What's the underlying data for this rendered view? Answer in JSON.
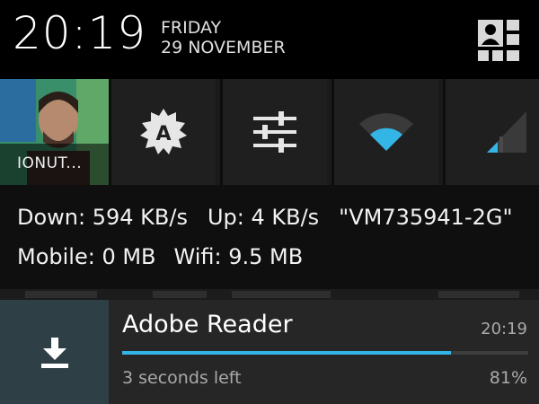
{
  "status": {
    "time": "20:19",
    "day": "FRIDAY",
    "date": "29 NOVEMBER"
  },
  "quick_settings": {
    "profile_name": "IONUT...",
    "tiles": [
      "user-grid-icon",
      "auto-brightness-icon",
      "settings-sliders-icon",
      "wifi-icon",
      "cell-signal-icon"
    ]
  },
  "network": {
    "down": "Down: 594 KB/s",
    "up": "Up: 4 KB/s",
    "ssid": "\"VM735941-2G\"",
    "mobile": "Mobile: 0 MB",
    "wifi": "Wifi: 9.5 MB"
  },
  "notification": {
    "title": "Adobe Reader",
    "time": "20:19",
    "subtitle": "3 seconds left",
    "percent_label": "81%",
    "progress": 0.81,
    "icon": "download-icon"
  },
  "colors": {
    "accent": "#33b5e5",
    "notif_icon_bg": "#2e3f45"
  }
}
